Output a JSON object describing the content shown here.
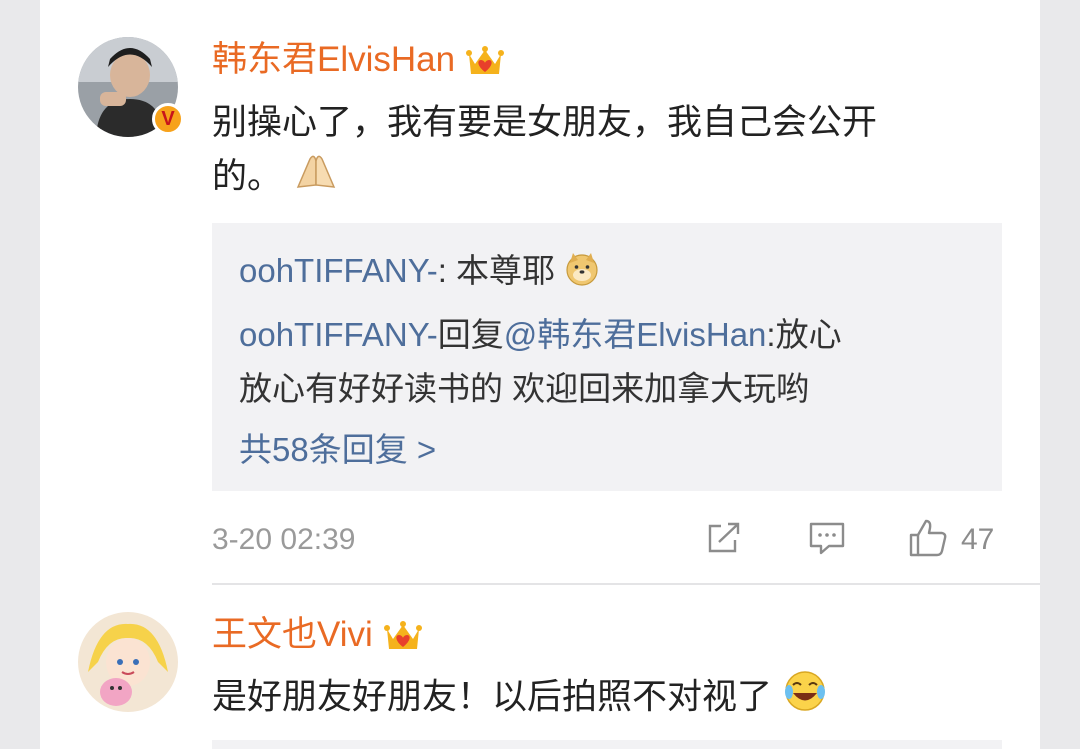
{
  "comments": [
    {
      "username": "韩东君ElvisHan",
      "text_line1": "别操心了，我有要是女朋友，我自己会公开",
      "text_line2": "的。",
      "verified_badge": "V",
      "replies": {
        "reply1_name": "oohTIFFANY-",
        "reply1_sep": ": ",
        "reply1_text": "本尊耶",
        "reply2_name": "oohTIFFANY-",
        "reply2_text_a": "回复",
        "reply2_mention": "@韩东君ElvisHan",
        "reply2_text_b": ":放心",
        "reply2_line2": "放心有好好读书的 欢迎回来加拿大玩哟",
        "more_label": "共58条回复 >"
      },
      "timestamp": "3-20 02:39",
      "like_count": "47"
    },
    {
      "username": "王文也Vivi",
      "text": "是好朋友好朋友！以后拍照不对视了"
    }
  ],
  "icons": {
    "crown": "crown-heart-icon",
    "share": "share-icon",
    "comment": "comment-icon",
    "like": "thumbs-up-icon",
    "pray": "pray-emoji",
    "doge": "doge-emoji",
    "laugh": "laugh-cry-emoji"
  },
  "colors": {
    "username": "#e96a24",
    "reply_name": "#4e6e9b",
    "reply_bg": "#f2f2f4",
    "meta_gray": "#9a9a9a"
  }
}
